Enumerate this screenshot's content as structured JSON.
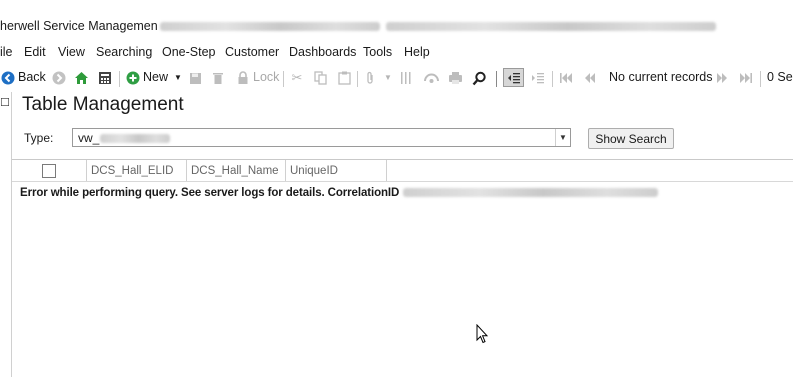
{
  "window": {
    "title": "herwell Service Managemen"
  },
  "menu": {
    "items": [
      "ile",
      "Edit",
      "View",
      "Searching",
      "One-Step",
      "Customer",
      "Dashboards",
      "Tools",
      "Help"
    ]
  },
  "toolbar": {
    "back_label": "Back",
    "new_label": "New",
    "lock_label": "Lock",
    "record_status": "No current records",
    "count_label": "0 Se"
  },
  "page": {
    "title": "Table Management"
  },
  "search": {
    "type_label": "Type:",
    "type_value": "vw_",
    "show_search_label": "Show Search"
  },
  "grid": {
    "columns": [
      "DCS_Hall_ELID",
      "DCS_Hall_Name",
      "UniqueID"
    ],
    "error_message": "Error while performing query. See server logs for details. CorrelationID"
  },
  "colors": {
    "accent_blue": "#1e6fc4",
    "home_green": "#2e9b3a",
    "new_green": "#2f9e44"
  }
}
